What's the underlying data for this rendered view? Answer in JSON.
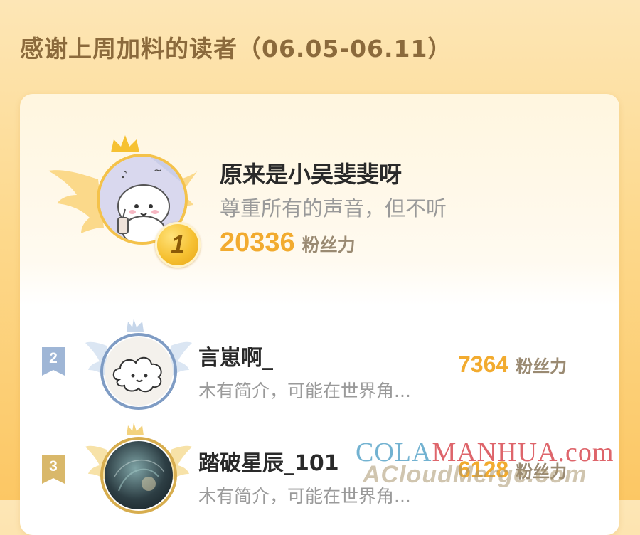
{
  "header": {
    "title": "感谢上周加料的读者（06.05-06.11）"
  },
  "top_reader": {
    "rank": "1",
    "name": "原来是小吴斐斐呀",
    "bio": "尊重所有的声音，但不听",
    "score": "20336",
    "score_unit": "粉丝力",
    "avatar_icon": "cartoon-puppy-avatar"
  },
  "readers": [
    {
      "rank": "2",
      "name": "言崽啊_",
      "bio": "木有简介，可能在世界角...",
      "score": "7364",
      "score_unit": "粉丝力",
      "tag_color": "#9fb6d6",
      "avatar_icon": "cloud-face-avatar"
    },
    {
      "rank": "3",
      "name": "踏破星辰_101",
      "bio": "木有简介，可能在世界角...",
      "score": "6128",
      "score_unit": "粉丝力",
      "tag_color": "#d9b86a",
      "avatar_icon": "dark-swirl-avatar"
    }
  ],
  "watermark": {
    "line1_part1": "COLA",
    "line1_part2": "MANHUA.com",
    "line2": "ACloudMerge.com"
  },
  "colors": {
    "accent": "#f2ab2f",
    "gold_badge": "#f6c132",
    "silver": "#9fb6d6",
    "bronze": "#d9b86a"
  }
}
